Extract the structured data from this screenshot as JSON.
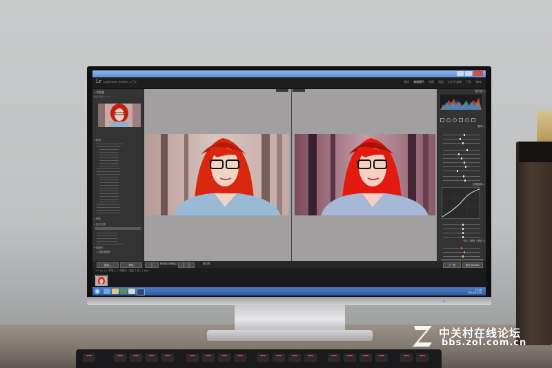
{
  "scene": "monitor-photo-lightroom-before-after",
  "app": {
    "logo": "Lr",
    "catalog": "Lightroom mobile 入门 ▾",
    "modules": [
      "图库",
      "修改照片",
      "地图",
      "画册",
      "幻灯片放映",
      "打印",
      "Web"
    ],
    "active_module": "修改照片"
  },
  "left_panel": {
    "navigator_header": "◂ 导航器",
    "zoom_options": "适合  填满  1:1  3:1",
    "presets_header": "▾ 预设",
    "snapshots_header": "▸ 快照",
    "history_header": "▾ 历史记录",
    "collections_header": "▾ 收藏夹",
    "collection_item": "▸ 智能收藏夹"
  },
  "center": {
    "mode_label": "修改前与修改后"
  },
  "right_panel": {
    "histogram_header": "直方图 ◂",
    "basic_header": "基本 ◂",
    "tone_curve_header": "色调曲线 ◂",
    "hsl_header": "HSL / 颜色 / 黑白 ◂"
  },
  "toolbar": {
    "copy_button": "复制...",
    "paste_button": "粘贴",
    "before_after_label": "修改前与修改后：",
    "soft_proof": "软打样",
    "prev_button": "上一张",
    "reset_button": "复位(Adobe)"
  },
  "filmstrip": {
    "breadcrumb": "1  2  ◂ ▸  上一次导入  /  1张照片 / 选定 1 张 / 1.jpg"
  },
  "taskbar": {
    "time": "11:20",
    "date": "2014/11/25"
  },
  "watermark": {
    "site_name": "中关村在线论坛",
    "url": "bbs.zol.com.cn"
  },
  "colors": {
    "accent_red_hair": "#d8260f",
    "lr_panel": "#333333",
    "center_bg": "#a29fa0",
    "taskbar_blue": "#2c5aa3"
  }
}
